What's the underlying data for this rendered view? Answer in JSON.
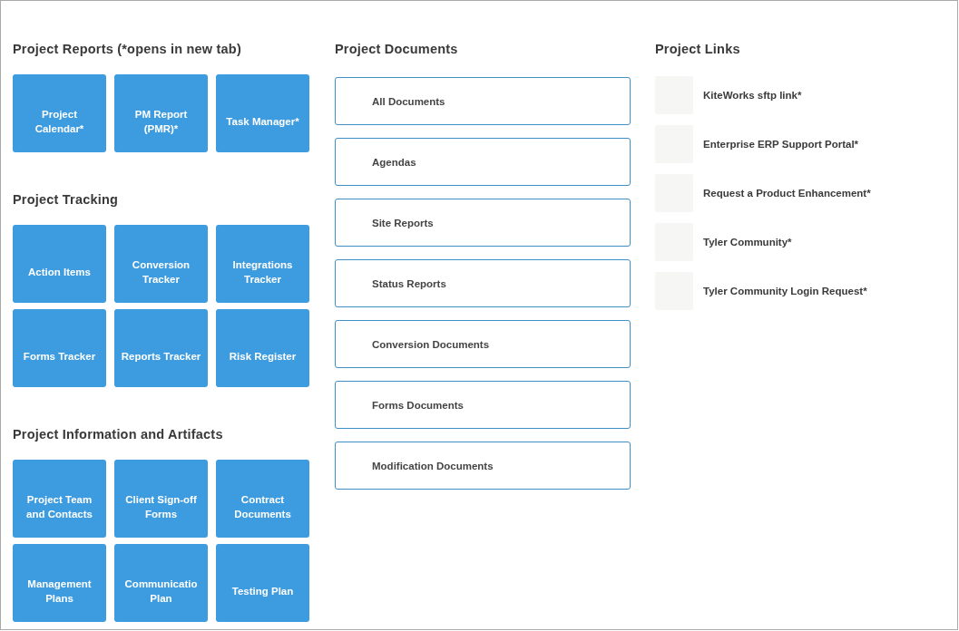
{
  "tile_sections": [
    {
      "title": "Project Reports (*opens in new tab)",
      "tiles": [
        "Project Calendar*",
        "PM Report (PMR)*",
        "Task Manager*"
      ]
    },
    {
      "title": "Project Tracking",
      "tiles": [
        "Action Items",
        "Conversion Tracker",
        "Integrations Tracker",
        "Forms Tracker",
        "Reports Tracker",
        "Risk Register"
      ]
    },
    {
      "title": "Project Information and Artifacts",
      "tiles": [
        "Project Team and Contacts",
        "Client Sign-off Forms",
        "Contract Documents",
        "Management Plans",
        "Communicatio Plan",
        "Testing Plan"
      ]
    }
  ],
  "documents": {
    "title": "Project Documents",
    "items": [
      "All Documents",
      "Agendas",
      "Site Reports",
      "Status Reports",
      "Conversion Documents",
      "Forms Documents",
      "Modification Documents"
    ]
  },
  "links": {
    "title": "Project Links",
    "items": [
      "KiteWorks sftp link*",
      "Enterprise ERP Support Portal*",
      "Request a Product Enhancement*",
      "Tyler Community*",
      "Tyler Community Login Request*"
    ]
  }
}
